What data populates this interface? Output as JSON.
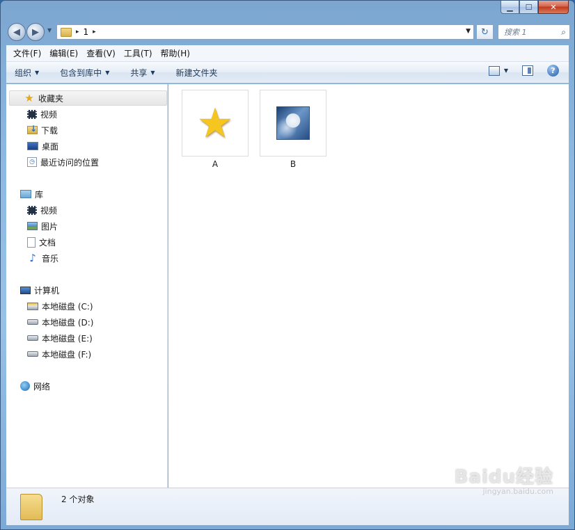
{
  "window": {
    "caption_buttons": {
      "minimize": "▁",
      "maximize": "☐",
      "close": "✕"
    }
  },
  "address_bar": {
    "back": "◀",
    "forward": "▶",
    "crumbs": [
      "1"
    ],
    "separator": "▸",
    "refresh": "↻",
    "search_placeholder": "搜索 1",
    "search_icon": "⌕"
  },
  "menu": [
    "文件(F)",
    "编辑(E)",
    "查看(V)",
    "工具(T)",
    "帮助(H)"
  ],
  "commands": {
    "organize": "组织",
    "include_in_library": "包含到库中",
    "share": "共享",
    "new_folder": "新建文件夹",
    "help": "?"
  },
  "nav_pane": {
    "favorites": {
      "label": "收藏夹",
      "items": [
        "视频",
        "下载",
        "桌面",
        "最近访问的位置"
      ]
    },
    "libraries": {
      "label": "库",
      "items": [
        "视频",
        "图片",
        "文档",
        "音乐"
      ]
    },
    "computer": {
      "label": "计算机",
      "items": [
        "本地磁盘 (C:)",
        "本地磁盘 (D:)",
        "本地磁盘 (E:)",
        "本地磁盘 (F:)"
      ]
    },
    "network": {
      "label": "网络"
    }
  },
  "files": [
    {
      "name": "A",
      "icon": "star-icon"
    },
    {
      "name": "B",
      "icon": "image-thumbnail"
    }
  ],
  "status": {
    "text": "2 个对象"
  },
  "watermark": {
    "main": "Baidu经验",
    "sub": "jingyan.baidu.com"
  }
}
